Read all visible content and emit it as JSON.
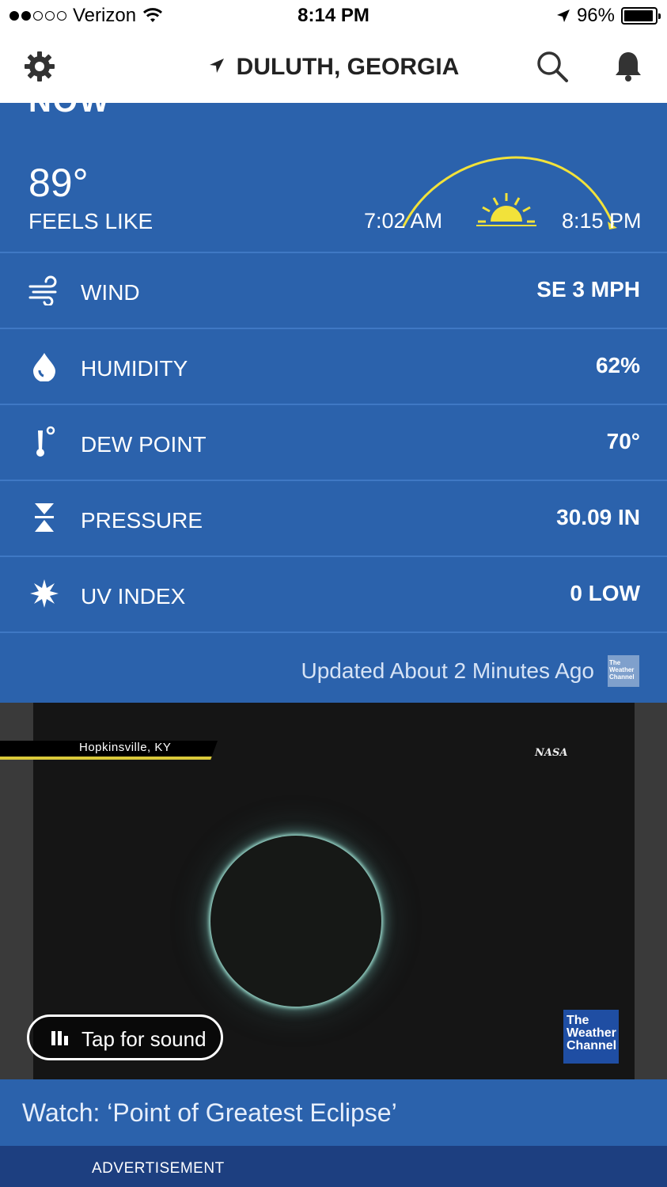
{
  "status_bar": {
    "carrier": "Verizon",
    "time": "8:14 PM",
    "battery": "96%",
    "battery_level": 0.96,
    "signal_bars_filled": 2,
    "signal_bars_total": 5
  },
  "header": {
    "location": "DULUTH, GEORGIA",
    "icons": [
      "gear-icon",
      "location-arrow-icon",
      "search-icon",
      "bell-icon"
    ]
  },
  "now": {
    "section_label": "NOW",
    "feels_like_temp": "89°",
    "feels_like_label": "FEELS LIKE",
    "sunrise": "7:02 AM",
    "sunset": "8:15 PM",
    "rows": [
      {
        "label": "WIND",
        "value": "SE 3 MPH",
        "icon": "wind-icon"
      },
      {
        "label": "HUMIDITY",
        "value": "62%",
        "icon": "droplet-icon"
      },
      {
        "label": "DEW POINT",
        "value": "70°",
        "icon": "thermometer-icon"
      },
      {
        "label": "PRESSURE",
        "value": "30.09 IN",
        "icon": "pressure-icon"
      },
      {
        "label": "UV INDEX",
        "value": "0 LOW",
        "icon": "sun-burst-icon"
      }
    ],
    "updated": "Updated About 2 Minutes Ago",
    "brand_small": "The Weather Channel"
  },
  "video": {
    "location_tag": "Hopkinsville, KY",
    "source_logo": "NASA",
    "sound_button": "Tap for sound",
    "brand_logo_lines": [
      "The",
      "Weather",
      "Channel"
    ],
    "caption": "Watch: ‘Point of Greatest Eclipse’"
  },
  "ad": {
    "label": "ADVERTISEMENT"
  },
  "colors": {
    "card_blue": "#2b62ac",
    "divider": "#3f78c4",
    "sun_yellow": "#f2e23a",
    "ad_navy": "#1d3f80"
  }
}
